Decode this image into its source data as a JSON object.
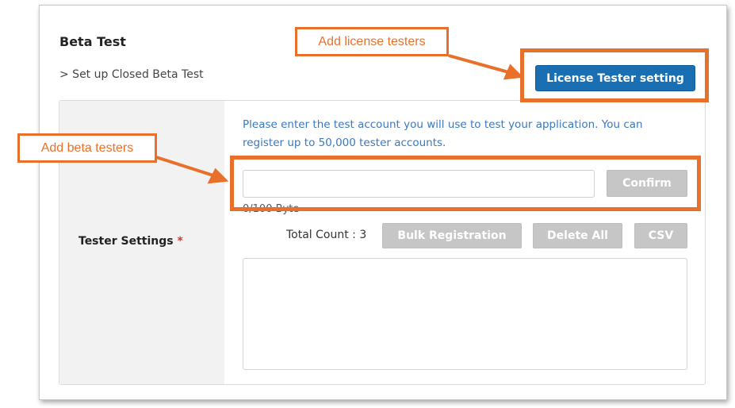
{
  "section": {
    "title": "Beta Test",
    "breadcrumb": "> Set up Closed Beta Test",
    "license_button": "License Tester setting"
  },
  "tester_settings": {
    "label": "Tester Settings",
    "required_mark": "*",
    "help_text": "Please enter the test account you will use to test your application. You can register up to 50,000 tester accounts.",
    "input_value": "",
    "confirm_button": "Confirm",
    "byte_count": "0/100 Byte",
    "total_count": "Total Count : 3",
    "bulk_button": "Bulk Registration",
    "delete_all_button": "Delete All",
    "csv_button": "CSV"
  },
  "annotations": {
    "license_callout": "Add license testers",
    "beta_callout": "Add beta testers",
    "accent_color": "#e8702a"
  },
  "colors": {
    "primary_button": "#1a6fb3",
    "disabled_button": "#c6c6c6",
    "help_text": "#3a78c0"
  }
}
